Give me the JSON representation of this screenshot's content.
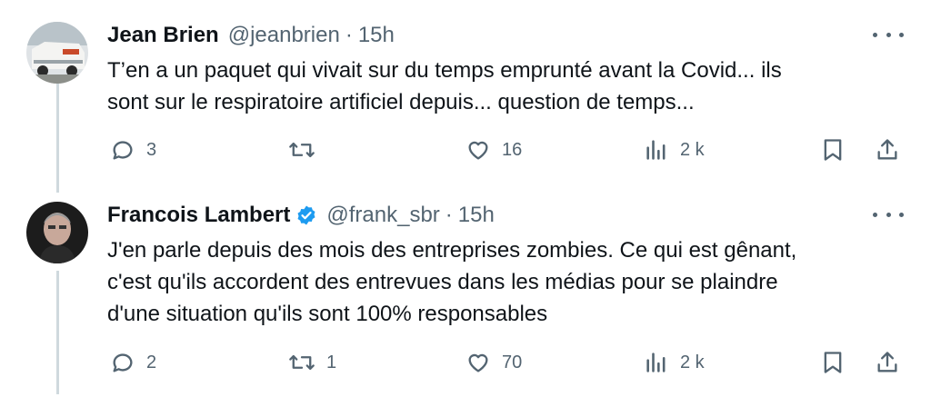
{
  "colors": {
    "text_primary": "#0f1419",
    "text_secondary": "#536471",
    "verified_blue": "#1d9bf0",
    "thread_line": "#cfd9de"
  },
  "tweets": [
    {
      "name": "Jean Brien",
      "handle": "@jeanbrien",
      "separator": "·",
      "time": "15h",
      "verified": false,
      "text_lines": [
        "T’en a un paquet qui vivait sur du temps emprunté avant la Covid... ils",
        "sont sur le respiratoire artificiel depuis... question de temps..."
      ],
      "replies": "3",
      "retweets": "",
      "likes": "16",
      "views": "2 k",
      "icons": [
        "reply-icon",
        "retweet-icon",
        "like-icon",
        "views-icon",
        "bookmark-icon",
        "share-icon",
        "more-icon"
      ]
    },
    {
      "name": "Francois Lambert",
      "handle": "@frank_sbr",
      "separator": "·",
      "time": "15h",
      "verified": true,
      "text_lines": [
        "J'en parle depuis des mois des entreprises zombies. Ce qui est gênant,",
        "c'est qu'ils accordent des entrevues dans les médias pour se plaindre",
        "d'une situation qu'ils sont 100% responsables"
      ],
      "replies": "2",
      "retweets": "1",
      "likes": "70",
      "views": "2 k",
      "icons": [
        "reply-icon",
        "retweet-icon",
        "like-icon",
        "views-icon",
        "bookmark-icon",
        "share-icon",
        "more-icon",
        "verified-badge-icon"
      ]
    }
  ]
}
